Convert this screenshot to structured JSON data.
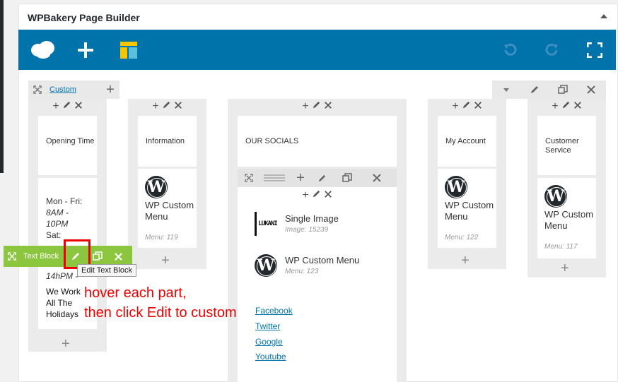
{
  "panel": {
    "title": "WPBakery Page Builder"
  },
  "toolbar": {
    "logo_icon": "wpbakery-cloud-icon",
    "add_icon": "plus-icon",
    "templates_icon": "templates-icon",
    "undo_icon": "undo-icon",
    "redo_icon": "redo-icon",
    "fullscreen_icon": "fullscreen-icon"
  },
  "row": {
    "layout_link": "Custom"
  },
  "columns": [
    {
      "label": "Opening Time"
    },
    {
      "label": "Information",
      "menu_title": "WP Custom Menu",
      "menu_sub": "Menu: 119"
    },
    {
      "label": "OUR SOCIALS"
    },
    {
      "label": "My Account",
      "menu_title": "WP Custom Menu",
      "menu_sub": "Menu: 122"
    },
    {
      "label": "Customer Service",
      "menu_title": "WP Custom Menu",
      "menu_sub": "Menu: 117"
    }
  ],
  "opening_text": {
    "line1": "Mon - Fri:",
    "line2": "8AM -",
    "line3": "10PM",
    "line4": "Sat:",
    "line5": "14hPM -",
    "line6": "We Work",
    "line7": "All The",
    "line8": "Holidays"
  },
  "inner": {
    "single_image_title": "Single Image",
    "single_image_sub": "Image: 15239",
    "custom_menu_title": "WP Custom Menu",
    "custom_menu_sub": "Menu: 123",
    "logo_text": "LUKANI"
  },
  "social_links": [
    "Facebook",
    "Twitter",
    "Google",
    "Youtube"
  ],
  "textblock_bar": {
    "label": "Text Block",
    "tooltip": "Edit Text Block"
  },
  "annotation": {
    "line1": "hover each part,",
    "line2": "then click Edit to custom"
  },
  "colors": {
    "toolbar": "#0073aa",
    "textblock": "#8cc63f",
    "annotation": "#e00000"
  }
}
